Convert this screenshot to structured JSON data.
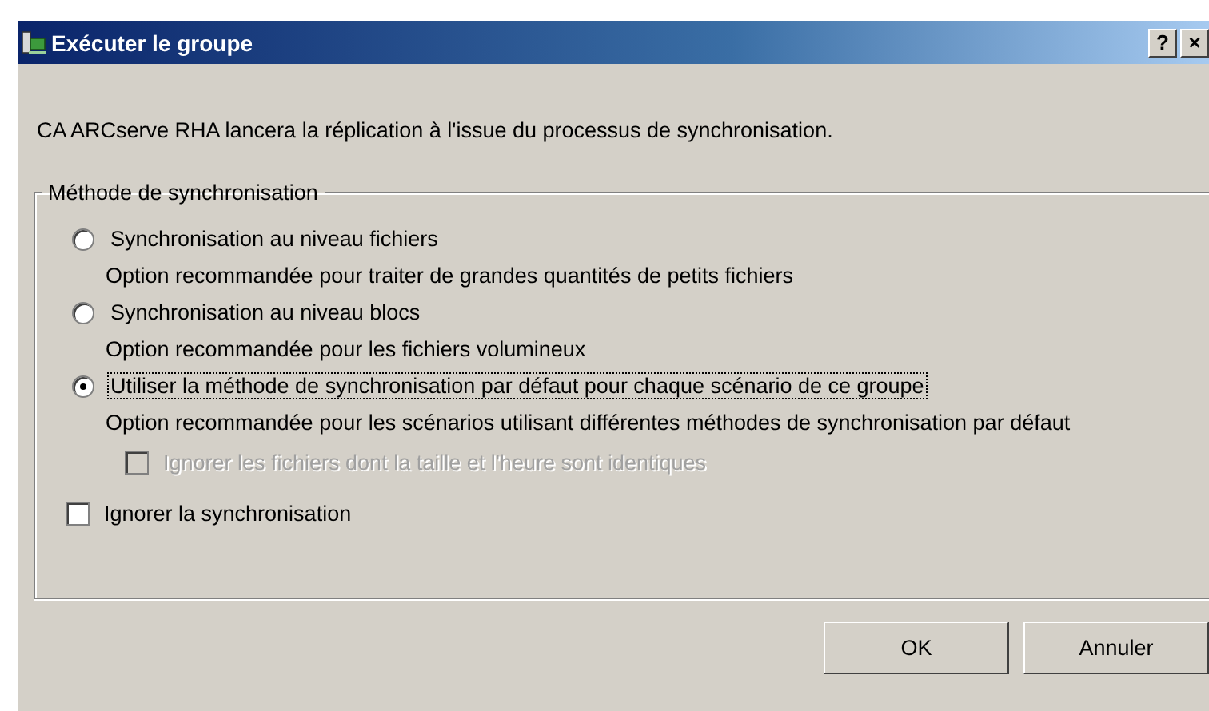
{
  "window": {
    "title": "Exécuter le groupe",
    "help_button": "?",
    "close_button": "×"
  },
  "message": "CA ARCserve RHA lancera la réplication à l'issue du processus de synchronisation.",
  "group": {
    "title": "Méthode de synchronisation",
    "options": [
      {
        "label": "Synchronisation au niveau fichiers",
        "description": "Option recommandée pour traiter de grandes quantités de petits fichiers",
        "selected": false,
        "focused": false
      },
      {
        "label": "Synchronisation au niveau blocs",
        "description": "Option recommandée pour les fichiers volumineux",
        "selected": false,
        "focused": false
      },
      {
        "label": "Utiliser la méthode de synchronisation par défaut pour chaque scénario de ce groupe",
        "description": "Option recommandée pour les scénarios utilisant différentes méthodes de synchronisation par défaut",
        "selected": true,
        "focused": true
      }
    ],
    "sub_checkbox": {
      "label": "Ignorer les fichiers dont la taille et l'heure sont identiques",
      "checked": false,
      "disabled": true
    },
    "skip_checkbox": {
      "label": "Ignorer la synchronisation",
      "checked": false,
      "disabled": false
    }
  },
  "buttons": [
    {
      "label": "OK"
    },
    {
      "label": "Annuler"
    }
  ]
}
